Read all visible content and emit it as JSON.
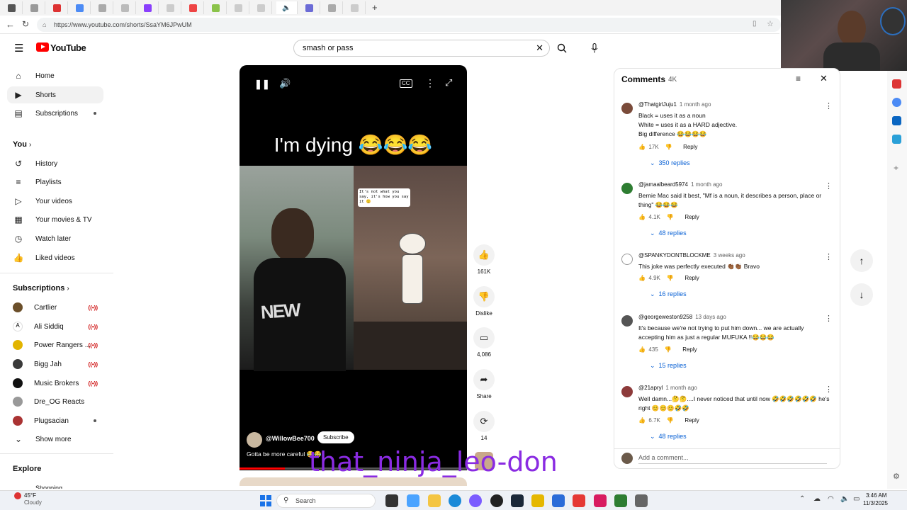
{
  "browser": {
    "url": "https://www.youtube.com/shorts/SsaYM6JPwUM"
  },
  "yt": {
    "logo_text": "YouTube",
    "search_value": "smash or pass"
  },
  "sidebar": {
    "main": [
      {
        "label": "Home",
        "icon": "home-icon"
      },
      {
        "label": "Shorts",
        "icon": "shorts-icon"
      },
      {
        "label": "Subscriptions",
        "icon": "subscriptions-icon"
      }
    ],
    "you_heading": "You",
    "you": [
      {
        "label": "History",
        "icon": "history-icon"
      },
      {
        "label": "Playlists",
        "icon": "playlists-icon"
      },
      {
        "label": "Your videos",
        "icon": "your-videos-icon"
      },
      {
        "label": "Your movies & TV",
        "icon": "movies-icon"
      },
      {
        "label": "Watch later",
        "icon": "watch-later-icon"
      },
      {
        "label": "Liked videos",
        "icon": "liked-icon"
      }
    ],
    "subs_heading": "Subscriptions",
    "subs": [
      {
        "label": "Cartlier",
        "status": "live"
      },
      {
        "label": "Ali Siddiq",
        "status": "live"
      },
      {
        "label": "Power Rangers ...",
        "status": "live"
      },
      {
        "label": "Bigg Jah",
        "status": "live"
      },
      {
        "label": "Music Brokers",
        "status": "live"
      },
      {
        "label": "Dre_OG Reacts",
        "status": ""
      },
      {
        "label": "Plugsacian",
        "status": "dot"
      }
    ],
    "show_more": "Show more",
    "explore_heading": "Explore",
    "explore_partial": "Shopping"
  },
  "video": {
    "overlay_caption": "I'm dying 😂😂😂",
    "speech_bubble": "It's not what you say, it's how you say it 😐",
    "channel": "@WillowBee700",
    "subscribe_label": "Subscribe",
    "description": "Gotta be more careful 😂😂"
  },
  "actions": {
    "like_count": "161K",
    "dislike_label": "Dislike",
    "comment_count": "4,086",
    "share_label": "Share",
    "remix_count": "14"
  },
  "comments": {
    "title": "Comments",
    "count": "4K",
    "add_placeholder": "Add a comment...",
    "items": [
      {
        "user": "@ThatgirlJuju1",
        "time": "1 month ago",
        "text": "Black = uses it as a noun\nWhite = uses it as a HARD adjective.\nBig difference 😂😂😂😂",
        "likes": "17K",
        "reply": "Reply",
        "replies": "350 replies",
        "avatar_color": "#7a4b3a"
      },
      {
        "user": "@jamaalbeard5974",
        "time": "1 month ago",
        "text": "Bernie Mac said it best, \"Mf is a noun, it describes a person, place or thing\" 😂😂😂",
        "likes": "4.1K",
        "reply": "Reply",
        "replies": "48 replies",
        "avatar_color": "#2e7d32"
      },
      {
        "user": "@SPANKYDONTBLOCKME",
        "time": "3 weeks ago",
        "text": "This joke was perfectly executed 👏🏾👏🏾 Bravo",
        "likes": "4.9K",
        "reply": "Reply",
        "replies": "16 replies",
        "avatar_color": "#ffffff"
      },
      {
        "user": "@georgeweston9258",
        "time": "13 days ago",
        "text": "It's because we're not trying to put him down... we are actually accepting him as just a regular MUFUKA !!😂😂😂",
        "likes": "435",
        "reply": "Reply",
        "replies": "15 replies",
        "avatar_color": "#555555"
      },
      {
        "user": "@21apryl",
        "time": "1 month ago",
        "text": "Well damn...🤔🤔....I never noticed that until now 🤣🤣🤣🤣🤣🤣 he's right 😊😊😊🤣🤣",
        "likes": "6.7K",
        "reply": "Reply",
        "replies": "48 replies",
        "avatar_color": "#8d3b3b"
      }
    ]
  },
  "overlay": {
    "watermark": "that_ninja_leo-don"
  },
  "taskbar": {
    "weather_temp": "45°F",
    "weather_desc": "Cloudy",
    "search_label": "Search",
    "time": "3:46 AM",
    "date": "11/3/2025"
  }
}
